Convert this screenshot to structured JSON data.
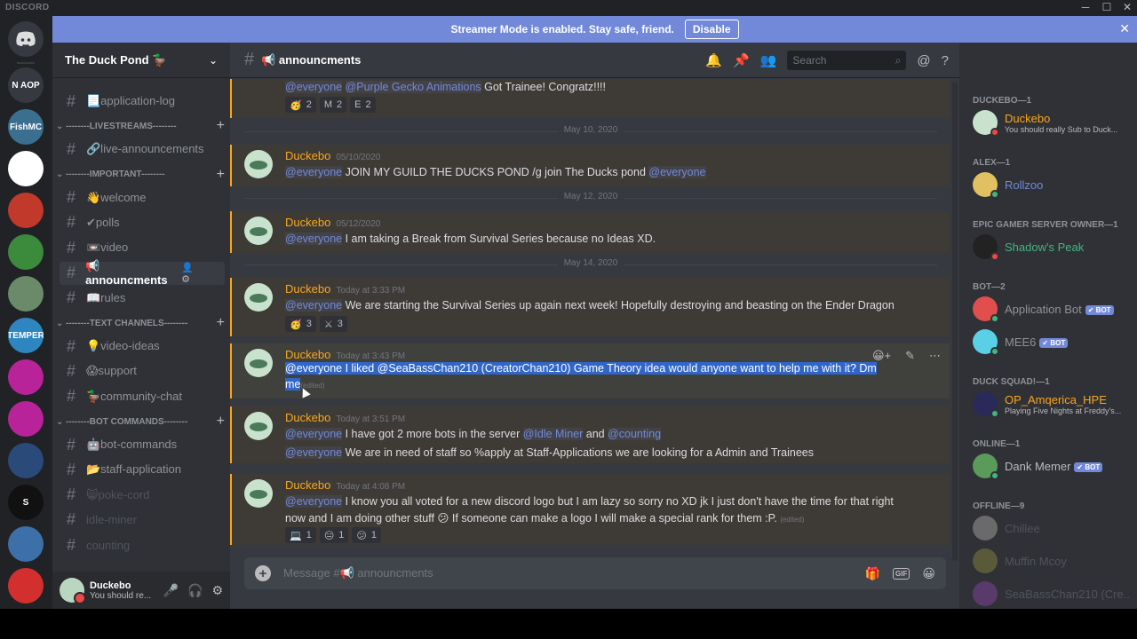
{
  "app": {
    "brand": "DISCORD"
  },
  "window_controls": {
    "minimize": "─",
    "maximize": "☐",
    "close": "✕"
  },
  "banner": {
    "text": "Streamer Mode is enabled. Stay safe, friend.",
    "disable": "Disable",
    "close": "✕"
  },
  "servers": [
    {
      "label": "N AOP",
      "color": "#36393f"
    },
    {
      "label": "FishMC",
      "color": "#3b6f8f"
    },
    {
      "label": "",
      "color": "#ffffff"
    },
    {
      "label": "",
      "color": "#c0392b"
    },
    {
      "label": "",
      "color": "#3c8a3c"
    },
    {
      "label": "",
      "color": "#6a8a6a"
    },
    {
      "label": "TEMPER",
      "color": "#2e86c1"
    },
    {
      "label": "",
      "color": "#b9239a"
    },
    {
      "label": "",
      "color": "#b9239a"
    },
    {
      "label": "",
      "color": "#2a4a7a"
    },
    {
      "label": "S",
      "color": "#111111"
    },
    {
      "label": "",
      "color": "#3d6fa8"
    },
    {
      "label": "",
      "color": "#d32f2f"
    }
  ],
  "guild": {
    "name": "The Duck Pond 🦆",
    "chevron": "⌄"
  },
  "channels": {
    "top": [
      {
        "name": "📃application-log"
      }
    ],
    "categories": [
      {
        "name": "--------LIVESTREAMS--------",
        "channels": [
          {
            "name": "🔗live-announcements"
          }
        ]
      },
      {
        "name": "--------IMPORTANT--------",
        "channels": [
          {
            "name": "👋welcome"
          },
          {
            "name": "✔polls"
          },
          {
            "name": "📼video"
          },
          {
            "name": "📢 announcments",
            "active": true
          },
          {
            "name": "📖rules"
          }
        ]
      },
      {
        "name": "--------TEXT CHANNELS--------",
        "channels": [
          {
            "name": "💡video-ideas"
          },
          {
            "name": "😱support"
          },
          {
            "name": "🦆community-chat"
          }
        ]
      },
      {
        "name": "--------BOT COMMANDS--------",
        "channels": [
          {
            "name": "🤖bot-commands"
          },
          {
            "name": "📂staff-application"
          },
          {
            "name": "😸poke-cord",
            "muted": true
          },
          {
            "name": "idle-miner",
            "muted": true
          },
          {
            "name": "counting",
            "muted": true
          }
        ]
      }
    ],
    "channel_tools": "👤 ⚙"
  },
  "user": {
    "name": "Duckebo",
    "status": "You should re...",
    "icons": [
      "🎤",
      "🎧",
      "⚙"
    ]
  },
  "header": {
    "channel": "📢 announcments",
    "search_placeholder": "Search",
    "icons": [
      "🔔",
      "📌",
      "👥",
      "@",
      "?"
    ]
  },
  "messages": {
    "top_partial": {
      "parts": [
        {
          "t": "@everyone",
          "m": true
        },
        {
          "t": " "
        },
        {
          "t": "@Purple Gecko Animations",
          "m": true
        },
        {
          "t": " Got Trainee! Congratz!!!!"
        }
      ],
      "reactions": [
        {
          "e": "🥳",
          "c": "2"
        },
        {
          "e": "M",
          "c": "2"
        },
        {
          "e": "E",
          "c": "2"
        }
      ]
    },
    "dividers": [
      "May 10, 2020",
      "May 12, 2020",
      "May 14, 2020"
    ],
    "m1": {
      "author": "Duckebo",
      "time": "05/10/2020",
      "parts": [
        {
          "t": "@everyone",
          "m": true
        },
        {
          "t": " JOIN MY GUILD THE DUCKS POND /g join The Ducks pond "
        },
        {
          "t": "@everyone",
          "m": true
        }
      ]
    },
    "m2": {
      "author": "Duckebo",
      "time": "05/12/2020",
      "parts": [
        {
          "t": "@everyone",
          "m": true
        },
        {
          "t": " I am taking a Break from Survival Series because no Ideas XD."
        }
      ]
    },
    "m3": {
      "author": "Duckebo",
      "time": "Today at 3:33 PM",
      "parts": [
        {
          "t": "@everyone",
          "m": true
        },
        {
          "t": " We are starting the Survival Series up again next week! Hopefully destroying and beasting on the Ender Dragon"
        }
      ],
      "reactions": [
        {
          "e": "🥳",
          "c": "3"
        },
        {
          "e": "⚔",
          "c": "3"
        }
      ]
    },
    "m4": {
      "author": "Duckebo",
      "time": "Today at 3:43 PM",
      "line1": [
        {
          "t": "@everyone",
          "m": true
        },
        {
          "t": "  I liked "
        },
        {
          "t": "@SeaBassChan210 (CreatorChan210)",
          "m": true
        },
        {
          "t": " Game Theory idea would anyone want to help me with it? Dm"
        }
      ],
      "line2": "me",
      "edited": "(edited)",
      "tools": [
        "😀+",
        "✎",
        "⋯"
      ]
    },
    "m5": {
      "author": "Duckebo",
      "time": "Today at 3:51 PM",
      "line1": [
        {
          "t": "@everyone",
          "m": true
        },
        {
          "t": "  I have got 2 more bots in the server "
        },
        {
          "t": "@Idle Miner",
          "m": true
        },
        {
          "t": " and "
        },
        {
          "t": "@counting",
          "m": true
        }
      ],
      "line2": [
        {
          "t": "@everyone",
          "m": true
        },
        {
          "t": " We are in need of staff so %apply at Staff-Applications we are looking for a Admin and Trainees"
        }
      ]
    },
    "m6": {
      "author": "Duckebo",
      "time": "Today at 4:08 PM",
      "line1": [
        {
          "t": "@everyone",
          "m": true
        },
        {
          "t": " I know you all voted for a new discord logo but I am lazy so sorry no XD jk I just don't have the time for that right"
        }
      ],
      "line2": "now and I am doing other stuff 😕 If someone can make a logo I will make a special rank for them :P.",
      "edited": "(edited)",
      "reactions": [
        {
          "e": "💻",
          "c": "1"
        },
        {
          "e": "😑",
          "c": "1"
        },
        {
          "e": "😕",
          "c": "1"
        }
      ]
    }
  },
  "composer": {
    "placeholder": "Message #📢 announcments",
    "plus": "+",
    "gif": "GIF",
    "icons": [
      "🎁",
      "😀"
    ]
  },
  "members": [
    {
      "cat": "DUCKEBO—1",
      "items": [
        {
          "name": "Duckebo",
          "sub": "You should really Sub to Duck...",
          "color": "#faa61a",
          "status": "#f04747",
          "av": "#c9e2cd"
        }
      ]
    },
    {
      "cat": "ALEX—1",
      "items": [
        {
          "name": "Rollzoo",
          "color": "#7289da",
          "status": "#43b581",
          "av": "#e0c060"
        }
      ]
    },
    {
      "cat": "EPIC GAMER SERVER OWNER—1",
      "items": [
        {
          "name": "Shadow's Peak",
          "color": "#43b581",
          "status": "#f04747",
          "av": "#222222"
        }
      ]
    },
    {
      "cat": "BOT—2",
      "items": [
        {
          "name": "Application Bot",
          "bot": "✔ BOT",
          "color": "#8e9297",
          "status": "#43b581",
          "av": "#e04e4e"
        },
        {
          "name": "MEE6",
          "bot": "✔ BOT",
          "color": "#8e9297",
          "status": "#43b581",
          "av": "#5ad0e6"
        }
      ]
    },
    {
      "cat": "DUCK SQUAD!—1",
      "items": [
        {
          "name": "OP_Amqerica_HPE",
          "sub": "Playing Five Nights at Freddy's...",
          "color": "#faa61a",
          "status": "#43b581",
          "av": "#2a2a5a"
        }
      ]
    },
    {
      "cat": "ONLINE—1",
      "items": [
        {
          "name": "Dank Memer",
          "bot": "✔ BOT",
          "color": "#b9bbbe",
          "status": "#43b581",
          "av": "#5a9a5a"
        }
      ]
    },
    {
      "cat": "OFFLINE—9",
      "items": [
        {
          "name": "Chillee",
          "color": "#4f545c",
          "av": "#6a6a6a"
        },
        {
          "name": "Muffin Mcoy",
          "color": "#4f545c",
          "av": "#5a5a3a"
        },
        {
          "name": "SeaBassChan210 (Cre...",
          "color": "#4f545c",
          "av": "#5a3a6a"
        }
      ]
    }
  ]
}
